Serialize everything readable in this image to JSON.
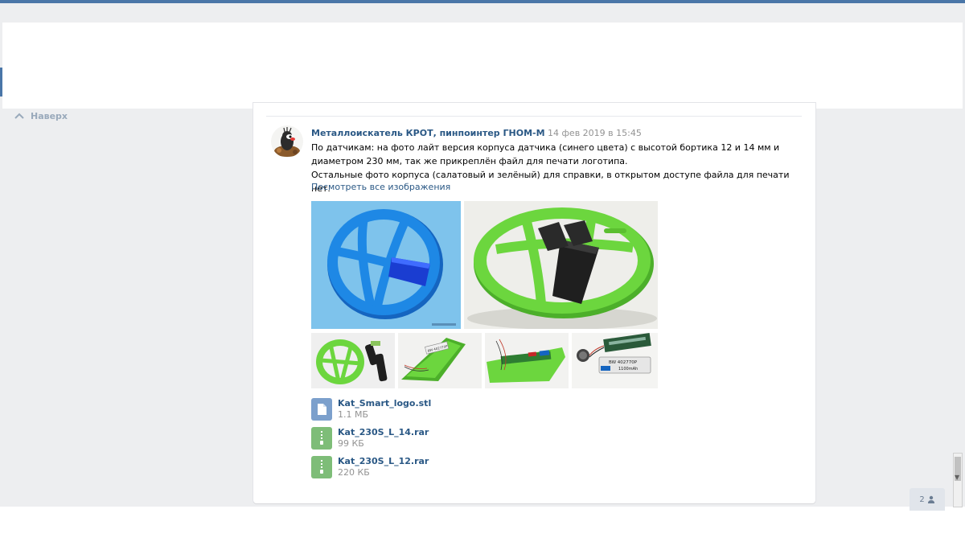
{
  "nav": {
    "back_to_top": "Наверх"
  },
  "post": {
    "author": "Металлоискатель КРОТ, пинпоинтер ГНОМ-М",
    "date": "14 фев 2019 в 15:45",
    "text_line1": "По датчикам: на фото лайт версия корпуса датчика (синего цвета) с высотой бортика 12 и 14 мм и диаметром 230 мм, так же прикреплён файл для печати логотипа.",
    "text_line2": "Остальные фото корпуса (салатовый и зелёный) для справки, в открытом доступе файла для печати нет.",
    "view_all_images": "Посмотреть все изображения",
    "attachments": [
      {
        "name": "Kat_Smart_logo.stl",
        "size": "1.1 МБ",
        "icon": "document-icon"
      },
      {
        "name": "Kat_230S_L_14.rar",
        "size": "99 КБ",
        "icon": "archive-icon"
      },
      {
        "name": "Kat_230S_L_12.rar",
        "size": "220 КБ",
        "icon": "archive-icon"
      }
    ],
    "photo_labels": {
      "battery_text": "BW 402770P",
      "battery_capacity": "1100mAh"
    }
  },
  "viewers": {
    "count": "2",
    "icon": "users-icon"
  },
  "colors": {
    "accent": "#2a5885",
    "background": "#edeef0",
    "brand_blue": "#4a76a8",
    "muted": "#939393",
    "sensor_blue": "#1e88e5",
    "sensor_green": "#6cd63e"
  }
}
